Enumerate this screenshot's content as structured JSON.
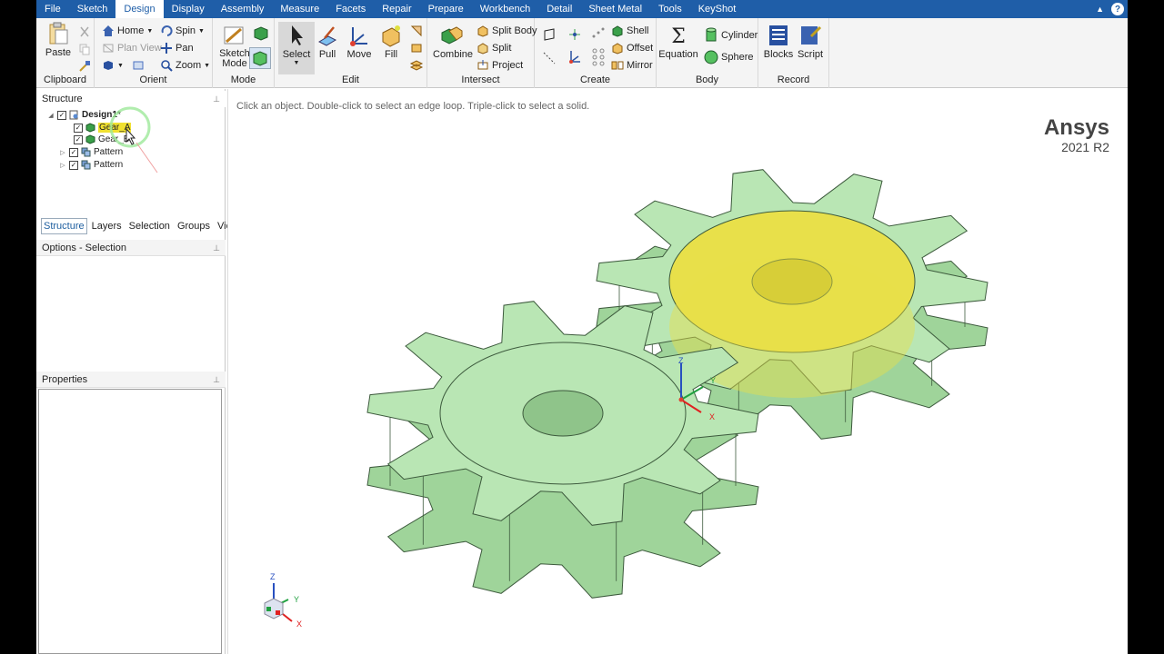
{
  "menu": {
    "tabs": [
      "File",
      "Sketch",
      "Design",
      "Display",
      "Assembly",
      "Measure",
      "Facets",
      "Repair",
      "Prepare",
      "Workbench",
      "Detail",
      "Sheet Metal",
      "Tools",
      "KeyShot"
    ],
    "active_tab": "Design",
    "help_label": "?"
  },
  "ribbon": {
    "clipboard": {
      "label": "Clipboard",
      "paste": "Paste"
    },
    "orient": {
      "label": "Orient",
      "home": "Home",
      "spin": "Spin",
      "plan_view": "Plan View",
      "pan": "Pan",
      "zoom": "Zoom"
    },
    "mode": {
      "label": "Mode",
      "sketch_mode": "Sketch Mode"
    },
    "edit": {
      "label": "Edit",
      "select": "Select",
      "pull": "Pull",
      "move": "Move",
      "fill": "Fill"
    },
    "intersect": {
      "label": "Intersect",
      "combine": "Combine",
      "split_body": "Split Body",
      "split": "Split",
      "project": "Project"
    },
    "create": {
      "label": "Create",
      "shell": "Shell",
      "offset": "Offset",
      "mirror": "Mirror"
    },
    "body": {
      "label": "Body",
      "equation": "Equation",
      "cylinder": "Cylinder",
      "sphere": "Sphere"
    },
    "record": {
      "label": "Record",
      "blocks": "Blocks",
      "script": "Script"
    }
  },
  "structure": {
    "title": "Structure",
    "root": "Design1*",
    "items": [
      {
        "label": "Gear_A",
        "type": "body",
        "checked": true,
        "highlight": true
      },
      {
        "label": "Gear_B",
        "type": "body",
        "checked": true
      },
      {
        "label": "Pattern",
        "type": "pattern",
        "checked": true
      },
      {
        "label": "Pattern",
        "type": "pattern",
        "checked": true
      }
    ]
  },
  "pane_tabs": [
    "Structure",
    "Layers",
    "Selection",
    "Groups",
    "Views"
  ],
  "active_pane_tab": "Structure",
  "options_title": "Options - Selection",
  "properties_title": "Properties",
  "viewport": {
    "hint": "Click an object. Double-click to select an edge loop. Triple-click to select a solid.",
    "brand": "Ansys",
    "version": "2021 R2",
    "axes": {
      "x": "X",
      "y": "Y",
      "z": "Z"
    }
  },
  "colors": {
    "menubar": "#1f5ea8",
    "gear_fill": "#b9e6b4",
    "gear_selected": "#e8e04a"
  }
}
